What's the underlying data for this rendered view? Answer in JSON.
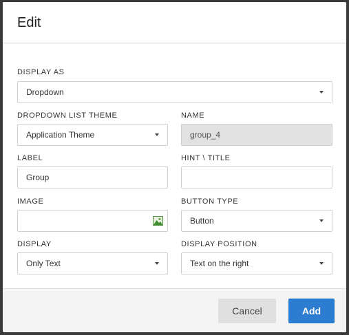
{
  "dialog": {
    "title": "Edit"
  },
  "display_as": {
    "label": "DISPLAY AS",
    "value": "Dropdown"
  },
  "dropdown_list_theme": {
    "label": "DROPDOWN LIST THEME",
    "value": "Application Theme"
  },
  "name": {
    "label": "NAME",
    "value": "group_4"
  },
  "label_field": {
    "label": "LABEL",
    "value": "Group"
  },
  "hint_title": {
    "label": "HINT \\ TITLE",
    "value": ""
  },
  "image": {
    "label": "IMAGE",
    "value": "",
    "icon": "image-icon"
  },
  "button_type": {
    "label": "BUTTON TYPE",
    "value": "Button"
  },
  "display": {
    "label": "DISPLAY",
    "value": "Only Text"
  },
  "display_position": {
    "label": "DISPLAY POSITION",
    "value": "Text on the right"
  },
  "footer": {
    "cancel_label": "Cancel",
    "add_label": "Add"
  },
  "colors": {
    "primary": "#2c7dd2",
    "cancel_bg": "#e0e0e0",
    "disabled_bg": "#e1e1e1"
  }
}
